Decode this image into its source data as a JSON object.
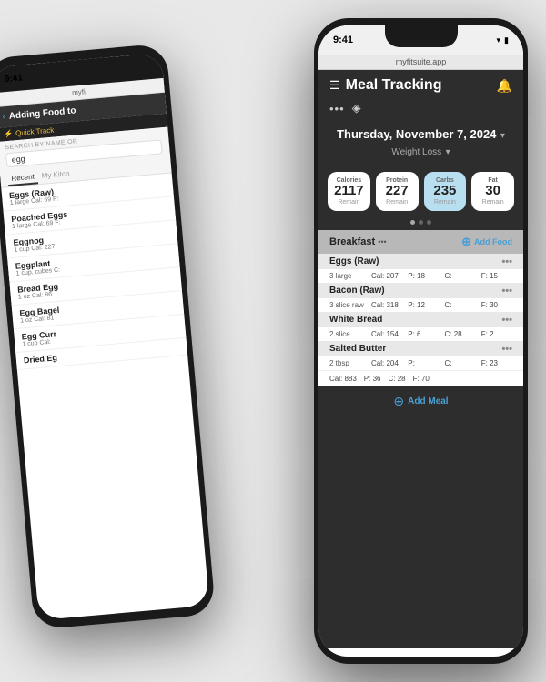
{
  "back_phone": {
    "time": "9:41",
    "url": "myfi",
    "header": {
      "back_label": "Adding Food to",
      "back_arrow": "‹"
    },
    "quick_track": "Quick Track",
    "search_label": "SEARCH BY NAME OR",
    "search_value": "egg",
    "tabs": [
      "Recent",
      "My Kitch"
    ],
    "food_items": [
      {
        "name": "Eggs (Raw)",
        "meta": "1 large   Cal: 69   P:"
      },
      {
        "name": "Poached Eggs",
        "meta": "1 large   Cal: 69   F:"
      },
      {
        "name": "Eggnog",
        "meta": "1 cup   Cal: 227"
      },
      {
        "name": "Eggplant",
        "meta": "1 cup, cubes   C:"
      },
      {
        "name": "Bread Egg",
        "meta": "1 oz   Cal: 86"
      },
      {
        "name": "Egg Bagel",
        "meta": "1 oz   Cal: 81"
      },
      {
        "name": "Egg Curr",
        "meta": "1 cup   Cal:"
      },
      {
        "name": "Dried Eg",
        "meta": ""
      }
    ]
  },
  "front_phone": {
    "time": "9:41",
    "url": "myfitsuite.app",
    "header_title": "Meal Tracking",
    "bell": "🔔",
    "toolbar": {
      "dots": "•••",
      "icon": "◈"
    },
    "date": "Thursday, November 7, 2024",
    "date_dropdown": "▾",
    "goal": "Weight Loss",
    "goal_dropdown": "▾",
    "nutrition_cards": [
      {
        "label": "Calories",
        "value": "2117",
        "sub": "Remain",
        "highlight": false
      },
      {
        "label": "Protein",
        "value": "227",
        "sub": "Remain",
        "highlight": false
      },
      {
        "label": "Carbs",
        "value": "235",
        "sub": "Remain",
        "highlight": true
      },
      {
        "label": "Fat",
        "value": "30",
        "sub": "Remain",
        "highlight": false
      }
    ],
    "meals": [
      {
        "name": "Breakfast",
        "foods": [
          {
            "name": "Eggs (Raw)",
            "qty": "3 large",
            "cal": "Cal: 207",
            "p": "P: 18",
            "c": "C:",
            "f": "F: 15"
          },
          {
            "name": "Bacon (Raw)",
            "qty": "3 slice raw",
            "cal": "Cal: 318",
            "p": "P: 12",
            "c": "C:",
            "f": "F: 30"
          },
          {
            "name": "White Bread",
            "qty": "2 slice",
            "cal": "Cal: 154",
            "p": "P: 6",
            "c": "C: 28",
            "f": "F: 2"
          },
          {
            "name": "Salted Butter",
            "qty": "2 tbsp",
            "cal": "Cal: 204",
            "p": "P:",
            "c": "C:",
            "f": "F: 23"
          }
        ],
        "total": {
          "cal": "Cal: 883",
          "p": "P: 36",
          "c": "C: 28",
          "f": "F: 70"
        }
      }
    ],
    "add_meal_label": "Add Meal"
  }
}
